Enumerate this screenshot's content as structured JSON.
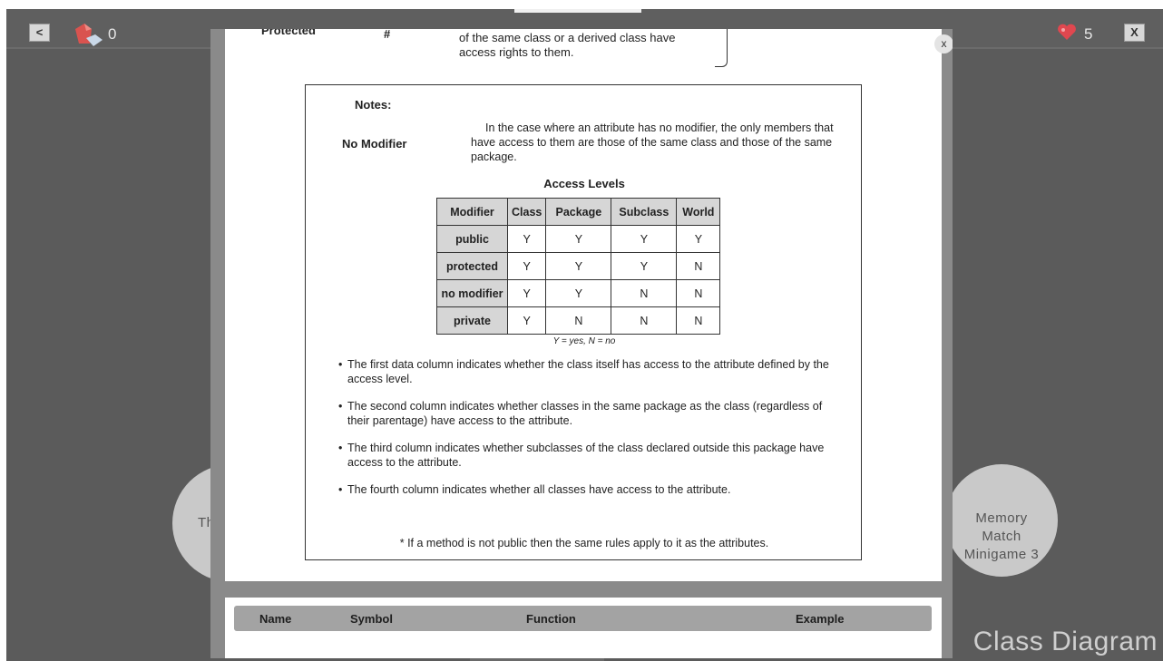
{
  "top_bar": {
    "back_label": "<",
    "gems_count": "0",
    "lives_count": "5",
    "close_label": "X"
  },
  "background": {
    "left_circle_text": "The",
    "right_circle_text": "Memory\nMatch\nMinigame 3",
    "watermark": "Class Diagram"
  },
  "modal": {
    "close_label": "x",
    "protected_row": {
      "label": "Protected",
      "symbol": "#",
      "description": "of the same class or a derived class have access rights to them."
    },
    "notes": {
      "title": "Notes:",
      "no_modifier_label": "No Modifier",
      "no_modifier_text": "In the case where an attribute has no modifier, the only members that have access to them are those of the same class and those of the same package.",
      "access_title": "Access Levels",
      "table": {
        "headers": [
          "Modifier",
          "Class",
          "Package",
          "Subclass",
          "World"
        ],
        "rows": [
          [
            "public",
            "Y",
            "Y",
            "Y",
            "Y"
          ],
          [
            "protected",
            "Y",
            "Y",
            "Y",
            "N"
          ],
          [
            "no modifier",
            "Y",
            "Y",
            "N",
            "N"
          ],
          [
            "private",
            "Y",
            "N",
            "N",
            "N"
          ]
        ]
      },
      "legend": "Y = yes, N = no",
      "bullets": [
        "The first data column indicates whether the class itself has access to the attribute defined by the access level.",
        "The second column indicates whether classes in the same package as the class (regardless of their parentage) have access to the attribute.",
        "The third column indicates whether subclasses of the class declared outside this package have access to the attribute.",
        "The fourth column indicates whether all classes have access to the attribute."
      ],
      "footnote": "* If a method is not public then the same rules apply to it as the attributes."
    },
    "header_row": {
      "name": "Name",
      "symbol": "Symbol",
      "function": "Function",
      "example": "Example"
    }
  },
  "colors": {
    "background": "#5b5b5b",
    "heart": "#e0474f",
    "gem": "#d9534f"
  }
}
